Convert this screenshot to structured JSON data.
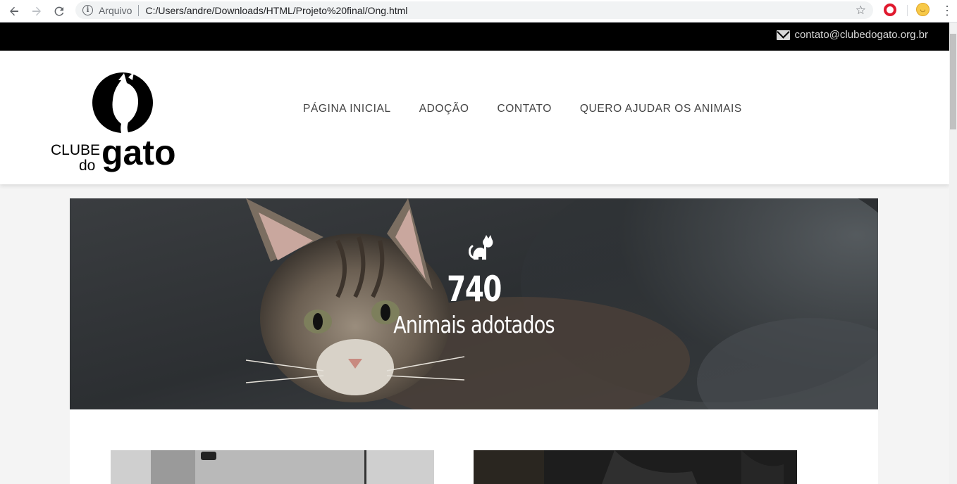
{
  "browser": {
    "scheme_label": "Arquivo",
    "url": "C:/Users/andre/Downloads/HTML/Projeto%20final/Ong.html",
    "back_icon": "back-arrow-icon",
    "forward_icon": "forward-arrow-icon",
    "reload_icon": "reload-icon",
    "star_icon": "star-icon",
    "menu_icon": "kebab-menu-icon"
  },
  "topbar": {
    "email": "contato@clubedogato.org.br",
    "icon": "envelope-icon"
  },
  "logo": {
    "line1": "CLUBE",
    "line2": "do",
    "line3": "gato"
  },
  "nav": {
    "items": [
      {
        "label": "PÁGINA INICIAL"
      },
      {
        "label": "ADOÇÃO"
      },
      {
        "label": "CONTATO"
      },
      {
        "label": "QUERO AJUDAR OS ANIMAIS"
      }
    ]
  },
  "hero": {
    "icon": "cat-icon",
    "number": "740",
    "label": "Animais adotados"
  },
  "colors": {
    "topbar": "#000000",
    "header": "#ffffff",
    "text_nav": "#444444"
  }
}
